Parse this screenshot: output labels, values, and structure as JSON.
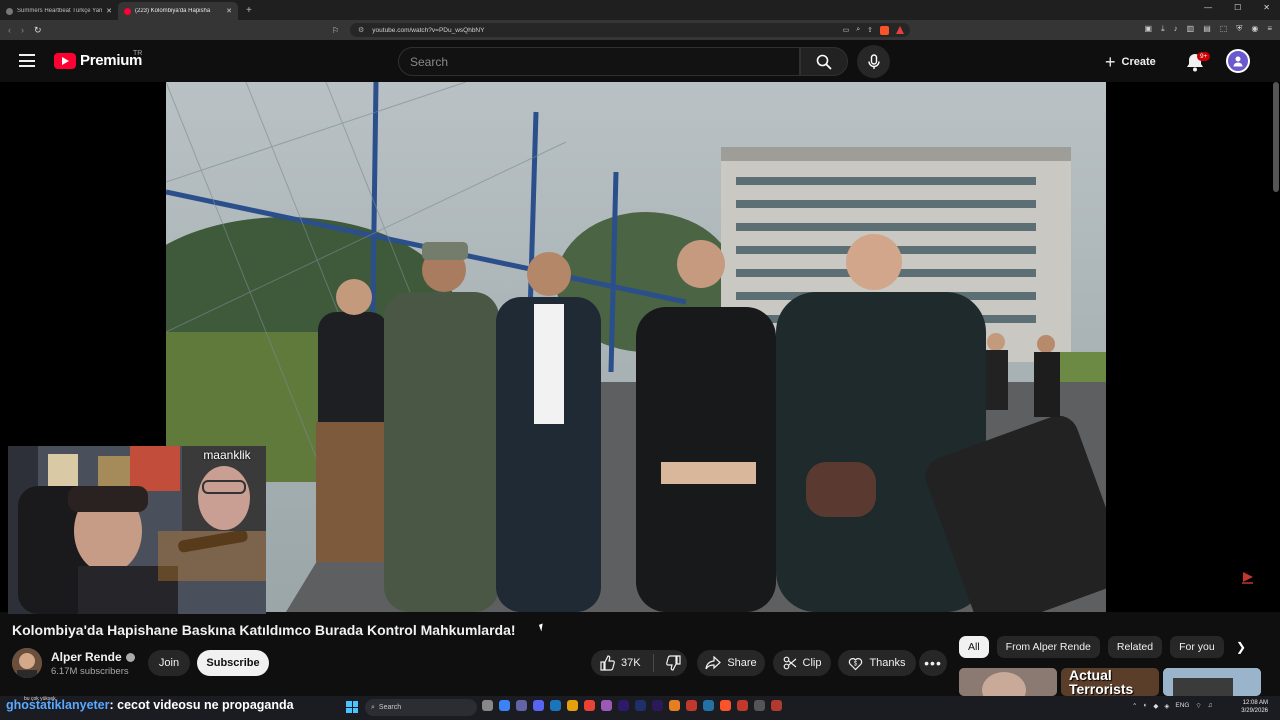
{
  "browser": {
    "tabs": [
      {
        "title": "Summers Heartbeat Türkçe Yama | C",
        "active": false
      },
      {
        "title": "(223) Kolombiya'da Hapisha",
        "active": true
      }
    ],
    "url": "youtube.com/watch?v=PDu_wsQhbNY"
  },
  "youtube": {
    "logo_text": "Premium",
    "country_code": "TR",
    "search_placeholder": "Search",
    "create_label": "Create",
    "notification_badge": "9+"
  },
  "webcam": {
    "overlay_label": "maanklik"
  },
  "video": {
    "title": "Kolombiya'da Hapishane Baskına Katıldımco Burada Kontrol Mahkumlarda!",
    "channel_name": "Alper Rende",
    "subscribers": "6.17M subscribers",
    "join_label": "Join",
    "subscribe_label": "Subscribe",
    "likes": "37K",
    "share_label": "Share",
    "clip_label": "Clip",
    "thanks_label": "Thanks",
    "more_label": "•••"
  },
  "sidebar": {
    "chips": [
      "All",
      "From Alper Rende",
      "Related",
      "For you"
    ],
    "thumb_text": "Actual Terrorists"
  },
  "overlay": {
    "ticker_user": "ghostatiklanyeter",
    "ticker_text": ": cecot videosu ne propaganda",
    "ticker_small": "bu çok yüksek"
  },
  "taskbar": {
    "search_placeholder": "Search",
    "lang": "ENG",
    "time": "12:08 AM",
    "date": "3/29/2026"
  },
  "colors": {
    "brand_red": "#ff0033",
    "background": "#0f0f0f",
    "chip_active": "#f1f1f1",
    "link_blue": "#5aa9ff"
  }
}
